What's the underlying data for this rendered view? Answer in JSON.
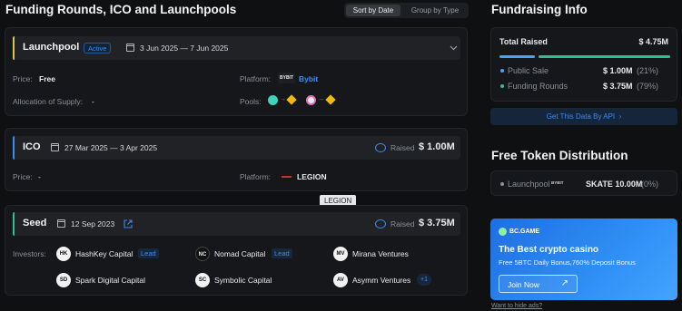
{
  "left": {
    "title": "Funding Rounds, ICO and Launchpools",
    "sort_by_date": "Sort by Date",
    "group_by_type": "Group by Type"
  },
  "launchpool": {
    "name": "Launchpool",
    "status": "Active",
    "dates": "3 Jun 2025 — 7 Jun 2025",
    "price_label": "Price:",
    "price": "Free",
    "allocation_label": "Allocation of Supply:",
    "allocation": "-",
    "platform_label": "Platform:",
    "platform_logo": "BYBIT",
    "platform": "Bybit",
    "pools_label": "Pools:",
    "accent": "#e0c24b"
  },
  "ico": {
    "name": "ICO",
    "dates": "27 Mar 2025 — 3 Apr 2025",
    "raised_label": "Raised",
    "raised": "$ 1.00M",
    "price_label": "Price:",
    "price": "-",
    "platform_label": "Platform:",
    "platform": "LEGION",
    "tooltip": "LEGION",
    "accent": "#3d8bf2"
  },
  "seed": {
    "name": "Seed",
    "dates": "12 Sep 2023",
    "raised_label": "Raised",
    "raised": "$ 3.75M",
    "investors_label": "Investors:",
    "lead": "Lead",
    "more": "+1",
    "accent": "#2fbf8f",
    "investors": [
      {
        "name": "HashKey Capital"
      },
      {
        "name": "Nomad Capital"
      },
      {
        "name": "Mirana Ventures"
      },
      {
        "name": "Spark Digital Capital"
      },
      {
        "name": "Symbolic Capital"
      },
      {
        "name": "Asymm Ventures"
      }
    ]
  },
  "fundraising": {
    "title": "Fundraising Info",
    "total_label": "Total Raised",
    "total": "$ 4.75M",
    "rows": [
      {
        "label": "Public Sale",
        "value": "$ 1.00M",
        "pct": "(21%)",
        "share": 0.21
      },
      {
        "label": "Funding Rounds",
        "value": "$ 3.75M",
        "pct": "(79%)",
        "share": 0.79
      }
    ],
    "api_link": "Get This Data By API",
    "colors": {
      "public": "#4aa3ff",
      "funding": "#2fbf8f"
    }
  },
  "distribution": {
    "title": "Free Token Distribution",
    "row_label": "Launchpool",
    "row_logo": "BYBIT",
    "row_value": "SKATE 10.00M",
    "row_pct": "(0%)"
  },
  "ad": {
    "brand": "BC.GAME",
    "headline": "The Best crypto casino",
    "sub": "Free 5BTC Daily Bonus,760% Deposit Bonus",
    "button": "Join Now",
    "hide_link": "Want to hide ads?"
  }
}
